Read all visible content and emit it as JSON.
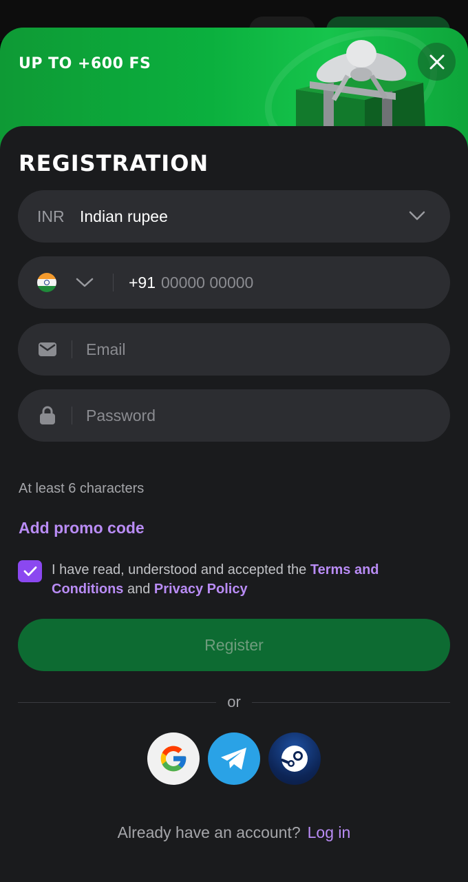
{
  "banner": {
    "title": "UP TO +600 FS"
  },
  "form": {
    "title": "REGISTRATION",
    "currency": {
      "code": "INR",
      "name": "Indian rupee"
    },
    "phone": {
      "country_code": "+91",
      "placeholder": "00000 00000"
    },
    "email": {
      "placeholder": "Email"
    },
    "password": {
      "placeholder": "Password",
      "hint": "At least 6 characters"
    },
    "promo_label": "Add promo code",
    "terms": {
      "checked": true,
      "prefix": "I have read, understood and accepted the ",
      "terms_link": "Terms and Conditions",
      "middle": " and ",
      "privacy_link": "Privacy Policy"
    },
    "register_label": "Register",
    "divider_text": "or",
    "social": [
      "google-icon",
      "telegram-icon",
      "steam-icon"
    ],
    "footer": {
      "question": "Already have an account?",
      "login_link": "Log in"
    }
  },
  "colors": {
    "accent_purple": "#b98cf5",
    "checkbox": "#8b48f0",
    "register_button": "#0d6b32",
    "banner_green": "#0bb03e",
    "field_bg": "#2c2d31",
    "card_bg": "#1a1b1d"
  }
}
